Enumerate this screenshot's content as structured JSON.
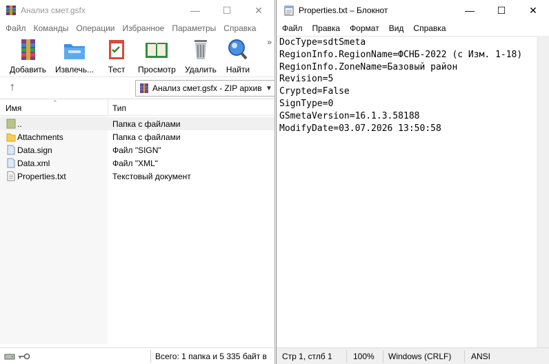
{
  "rar": {
    "title": "Анализ смет.gsfx",
    "menu": [
      "Файл",
      "Команды",
      "Операции",
      "Избранное",
      "Параметры",
      "Справка"
    ],
    "toolbar": [
      {
        "label": "Добавить",
        "icon": "add-archive-icon"
      },
      {
        "label": "Извлечь...",
        "icon": "extract-folder-icon"
      },
      {
        "label": "Тест",
        "icon": "test-clipboard-icon"
      },
      {
        "label": "Просмотр",
        "icon": "view-book-icon"
      },
      {
        "label": "Удалить",
        "icon": "trash-icon"
      },
      {
        "label": "Найти",
        "icon": "magnifier-icon"
      }
    ],
    "toolbar_more": "»",
    "address": "Анализ смет.gsfx - ZIP архив",
    "columns": {
      "name": "Имя",
      "type": "Тип"
    },
    "files": [
      {
        "name": "..",
        "type": "Папка с файлами",
        "icon": "folder-up-icon"
      },
      {
        "name": "Attachments",
        "type": "Папка с файлами",
        "icon": "folder-icon"
      },
      {
        "name": "Data.sign",
        "type": "Файл \"SIGN\"",
        "icon": "file-icon"
      },
      {
        "name": "Data.xml",
        "type": "Файл \"XML\"",
        "icon": "file-icon"
      },
      {
        "name": "Properties.txt",
        "type": "Текстовый документ",
        "icon": "text-file-icon"
      }
    ],
    "status": "Всего: 1 папка и 5 335 байт в"
  },
  "notepad": {
    "title": "Properties.txt – Блокнот",
    "menu": [
      "Файл",
      "Правка",
      "Формат",
      "Вид",
      "Справка"
    ],
    "lines": [
      "DocType=sdtSmeta",
      "RegionInfo.RegionName=ФСНБ-2022 (с Изм. 1-18)",
      "RegionInfo.ZoneName=Базовый район",
      "Revision=5",
      "Crypted=False",
      "SignType=0",
      "GSmetaVersion=16.1.3.58188",
      "ModifyDate=03.07.2026 13:50:58"
    ],
    "status": {
      "position": "Стр 1, стлб 1",
      "zoom": "100%",
      "eol": "Windows (CRLF)",
      "encoding": "ANSI"
    }
  }
}
